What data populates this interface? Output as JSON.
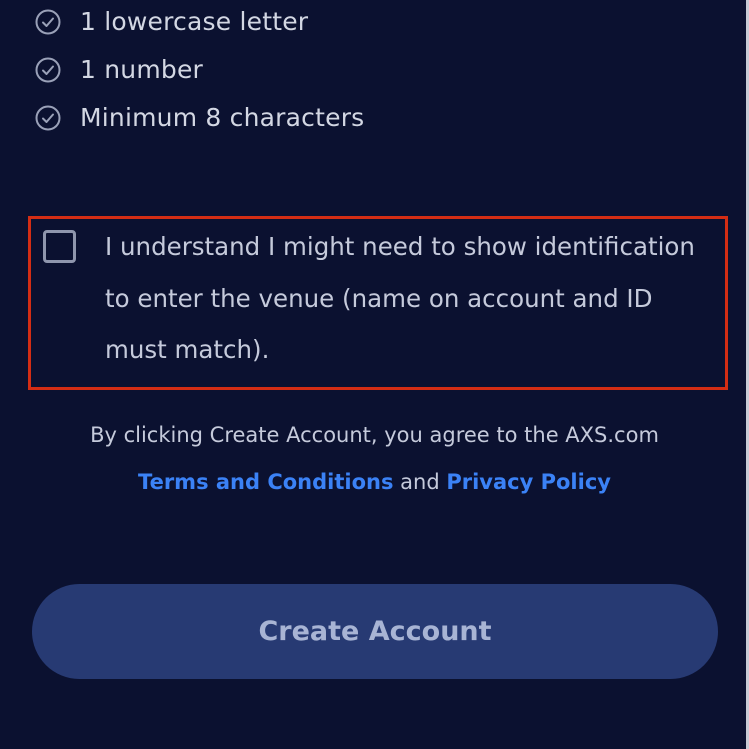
{
  "requirements": [
    {
      "label": "1 lowercase letter",
      "icon": "check-circle-icon"
    },
    {
      "label": "1 number",
      "icon": "check-circle-icon"
    },
    {
      "label": "Minimum 8 characters",
      "icon": "check-circle-icon"
    }
  ],
  "acknowledgement": {
    "text": "I understand I might need to show identification to enter the venue (name on account and ID must match).",
    "checked": false
  },
  "legal": {
    "prefix": "By clicking Create Account, you agree to the AXS.com",
    "terms_link": "Terms and Conditions",
    "connector": " and ",
    "privacy_link": "Privacy Policy"
  },
  "create_button": {
    "label": "Create Account"
  },
  "colors": {
    "background": "#0b1130",
    "link": "#3b82f6",
    "button_bg": "#273a73",
    "highlight_border": "#d42d14"
  }
}
